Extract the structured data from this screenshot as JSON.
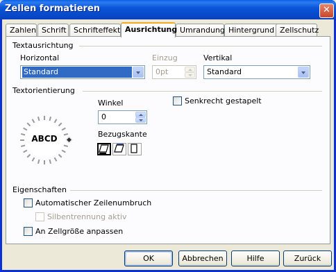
{
  "window": {
    "title": "Zellen formatieren",
    "close_glyph": "✕"
  },
  "tabs": [
    "Zahlen",
    "Schrift",
    "Schrifteffekt",
    "Ausrichtung",
    "Umrandung",
    "Hintergrund",
    "Zellschutz"
  ],
  "active_tab": "Ausrichtung",
  "alignment": {
    "section_title": "Textausrichtung",
    "horizontal": {
      "label": "Horizontal",
      "value": "Standard"
    },
    "indent": {
      "label": "Einzug",
      "value": "0pt"
    },
    "vertical": {
      "label": "Vertikal",
      "value": "Standard"
    }
  },
  "orientation": {
    "section_title": "Textorientierung",
    "dial_text": "ABCD",
    "angle": {
      "label": "Winkel",
      "value": "0"
    },
    "stacked": {
      "label": "Senkrecht gestapelt",
      "checked": false
    },
    "reference_edge": {
      "label": "Bezugskante"
    }
  },
  "properties": {
    "section_title": "Eigenschaften",
    "wrap": {
      "label": "Automatischer Zeilenumbruch",
      "checked": false
    },
    "hyphenation": {
      "label": "Silbentrennung aktiv",
      "checked": false
    },
    "shrink": {
      "label": "An Zellgröße anpassen",
      "checked": false
    }
  },
  "buttons": {
    "ok": "OK",
    "cancel": "Abbrechen",
    "help": "Hilfe",
    "back": "Zurück"
  },
  "colors": {
    "title_bar": "#0a55d8",
    "panel": "#fcfcfe",
    "dialog": "#ece9d8",
    "active_tab_accent": "#f5a925",
    "selection": "#316ac5"
  }
}
